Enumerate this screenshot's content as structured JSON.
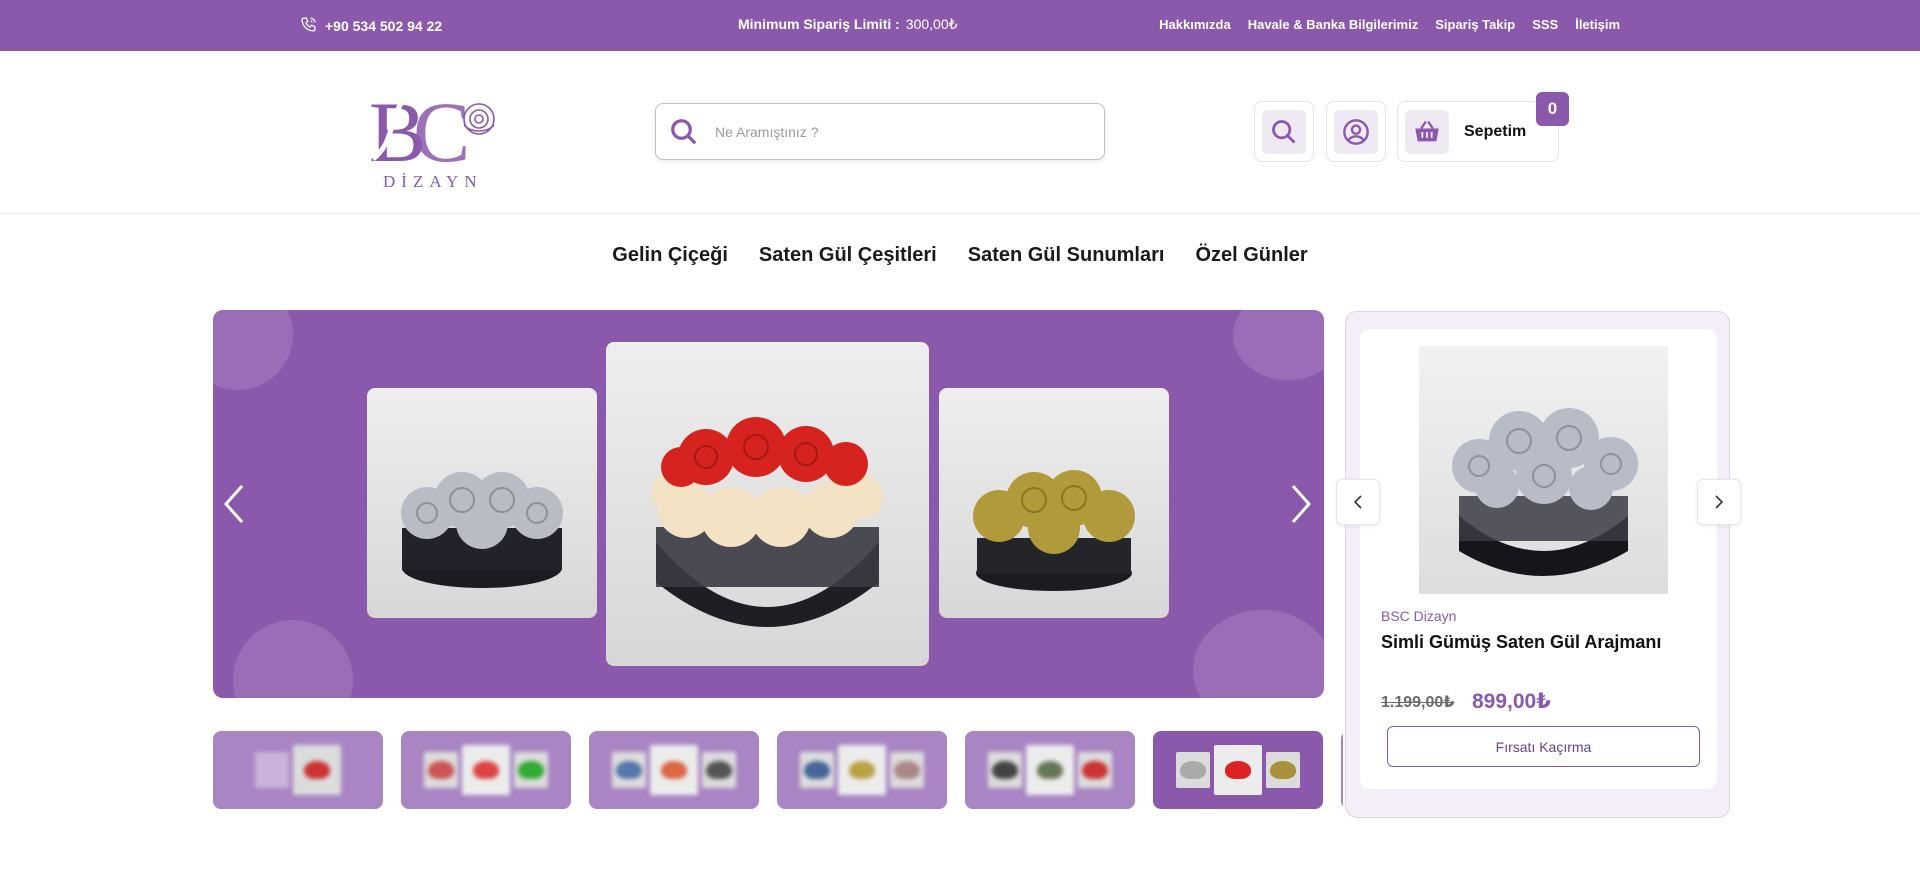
{
  "topbar": {
    "phone": "+90 534 502 94 22",
    "min_order_label": "Minimum Sipariş Limiti :",
    "min_order_value": "300,00₺",
    "links": [
      "Hakkımızda",
      "Havale & Banka Bilgilerimiz",
      "Sipariş Takip",
      "SSS",
      "İletişim"
    ]
  },
  "header": {
    "logo_initials": "BSC",
    "logo_sub": "DİZAYN",
    "search_placeholder": "Ne Aramıştınız ?",
    "cart_label": "Sepetim",
    "cart_count": "0"
  },
  "nav": [
    "Gelin Çiçeği",
    "Saten Gül Çeşitleri",
    "Saten Gül Sunumları",
    "Özel Günler"
  ],
  "colors": {
    "brand": "#8a59ac",
    "brand_light": "#efe9f4",
    "text": "#111111"
  },
  "product": {
    "brand": "BSC Dizayn",
    "name": "Simli Gümüş Saten Gül Arajmanı",
    "old_price": "1.199,00₺",
    "new_price": "899,00₺",
    "cta": "Fırsatı Kaçırma"
  },
  "icons": {
    "phone": "phone-icon",
    "search": "search-icon",
    "account": "user-icon",
    "cart": "basket-icon",
    "prev": "chevron-left-icon",
    "next": "chevron-right-icon"
  }
}
